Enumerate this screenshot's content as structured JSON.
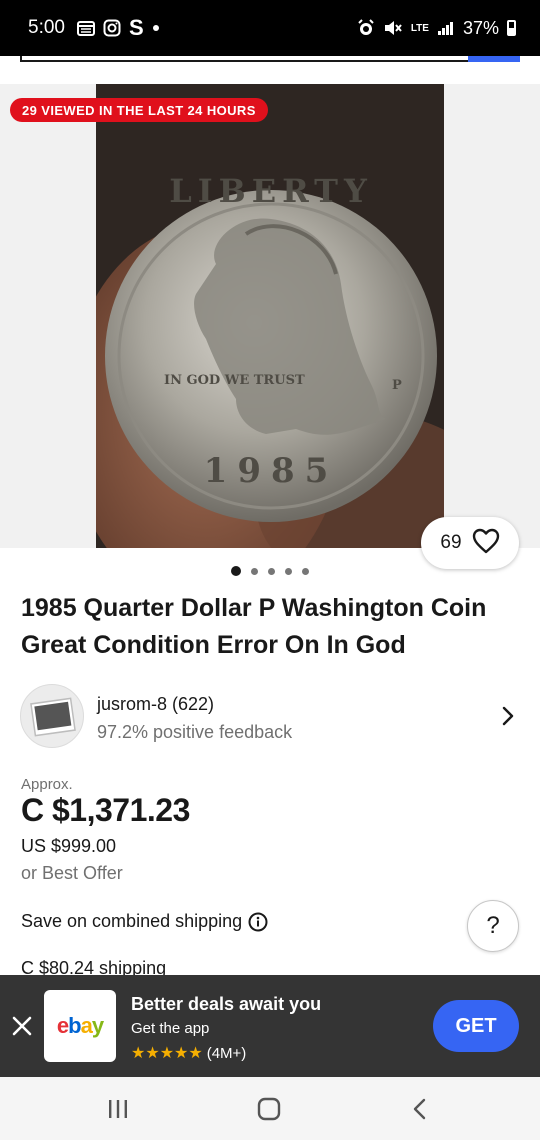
{
  "status_bar": {
    "time": "5:00",
    "left_icons": [
      "calendar-icon",
      "instagram-icon",
      "s-app-icon",
      "dot-icon"
    ],
    "s_glyph": "S",
    "network": "LTE",
    "battery": "37%"
  },
  "gallery": {
    "viewed_badge": "29 VIEWED IN THE LAST 24 HOURS",
    "watch_count": "69",
    "image_count": 5,
    "active_image_index": 0,
    "coin_legend": {
      "top": "LIBERTY",
      "motto": "IN GOD WE TRUST",
      "year": "1985",
      "mint_mark": "P"
    }
  },
  "listing": {
    "title": "1985 Quarter Dollar P Washington Coin Great Condition Error On In God"
  },
  "seller": {
    "name": "jusrom-8 (622)",
    "feedback": "97.2% positive feedback"
  },
  "price": {
    "approx_label": "Approx.",
    "converted": "C $1,371.23",
    "original": "US $999.00",
    "offer": "or Best Offer"
  },
  "shipping": {
    "combined_label": "Save on combined shipping",
    "cost": "C $80.24 shipping",
    "help_label": "?"
  },
  "app_banner": {
    "logo_letters": [
      "e",
      "b",
      "a",
      "y"
    ],
    "logo_colors": [
      "#e53238",
      "#0064d2",
      "#f5af02",
      "#86b817"
    ],
    "title": "Better deals await you",
    "subtitle": "Get the app",
    "rating_stars": "★★★★★",
    "rating_count": "(4M+)",
    "cta": "GET"
  },
  "colors": {
    "badge_red": "#e0101c",
    "accent_blue": "#3665f3",
    "banner_bg": "#343434",
    "star_gold": "#f5af02"
  }
}
